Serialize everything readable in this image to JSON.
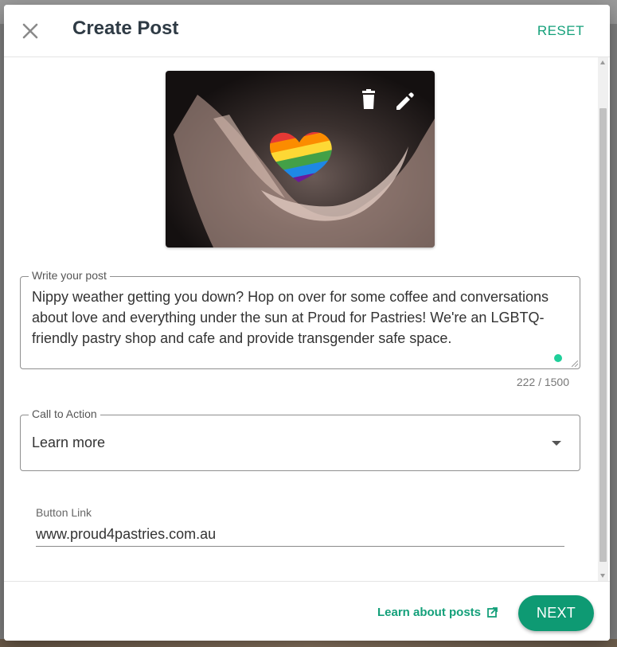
{
  "dialog": {
    "title": "Create Post",
    "reset_label": "RESET"
  },
  "image": {
    "description_icons": [
      "trash-icon",
      "pencil-icon"
    ]
  },
  "post": {
    "legend": "Write your post",
    "text": "Nippy weather getting you down? Hop on over for some coffee and conversations about love and everything under the sun at Proud for Pastries! We're an LGBTQ-friendly pastry shop and cafe and provide transgender safe space.",
    "counter": "222 / 1500"
  },
  "cta": {
    "legend": "Call to Action",
    "selected": "Learn more"
  },
  "button_link": {
    "label": "Button Link",
    "value": "www.proud4pastries.com.au"
  },
  "footer": {
    "learn_label": "Learn about posts",
    "next_label": "NEXT"
  },
  "colors": {
    "accent": "#14a07a",
    "next_button": "#0e9a73",
    "title": "#2f3b45"
  },
  "heart_stripes": [
    "#e53935",
    "#fb8c00",
    "#fdd835",
    "#43a047",
    "#1e88e5",
    "#6a1b9a"
  ]
}
